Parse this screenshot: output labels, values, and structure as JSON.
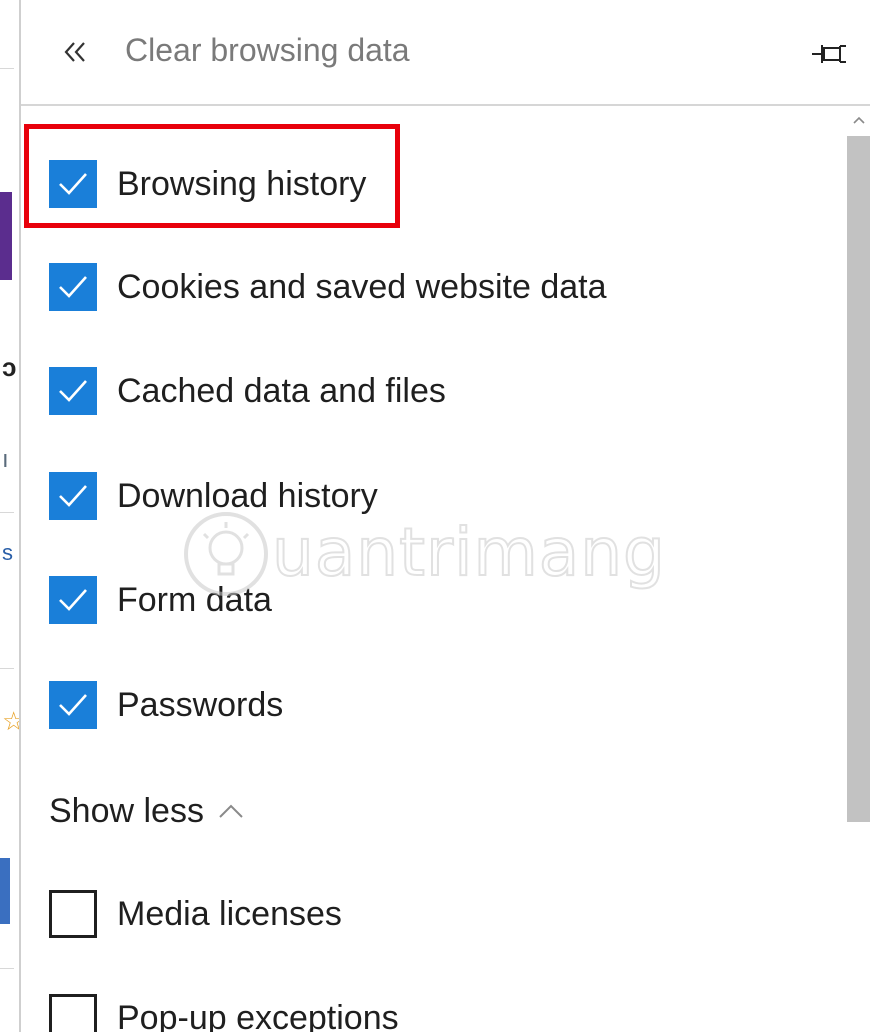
{
  "header": {
    "title": "Clear browsing data",
    "back_icon": "double-chevron-left-icon",
    "pin_icon": "pin-icon"
  },
  "items": [
    {
      "label": "Browsing history",
      "checked": true
    },
    {
      "label": "Cookies and saved website data",
      "checked": true
    },
    {
      "label": "Cached data and files",
      "checked": true
    },
    {
      "label": "Download history",
      "checked": true
    },
    {
      "label": "Form data",
      "checked": true
    },
    {
      "label": "Passwords",
      "checked": true
    },
    {
      "label": "Media licenses",
      "checked": false
    },
    {
      "label": "Pop-up exceptions",
      "checked": false
    }
  ],
  "toggle": {
    "label": "Show less"
  },
  "watermark": {
    "text": "uantrimang"
  },
  "colors": {
    "accent": "#1a7fd9",
    "highlight": "#e8000b",
    "title": "#7a7a7a",
    "text": "#1f1f1f"
  }
}
